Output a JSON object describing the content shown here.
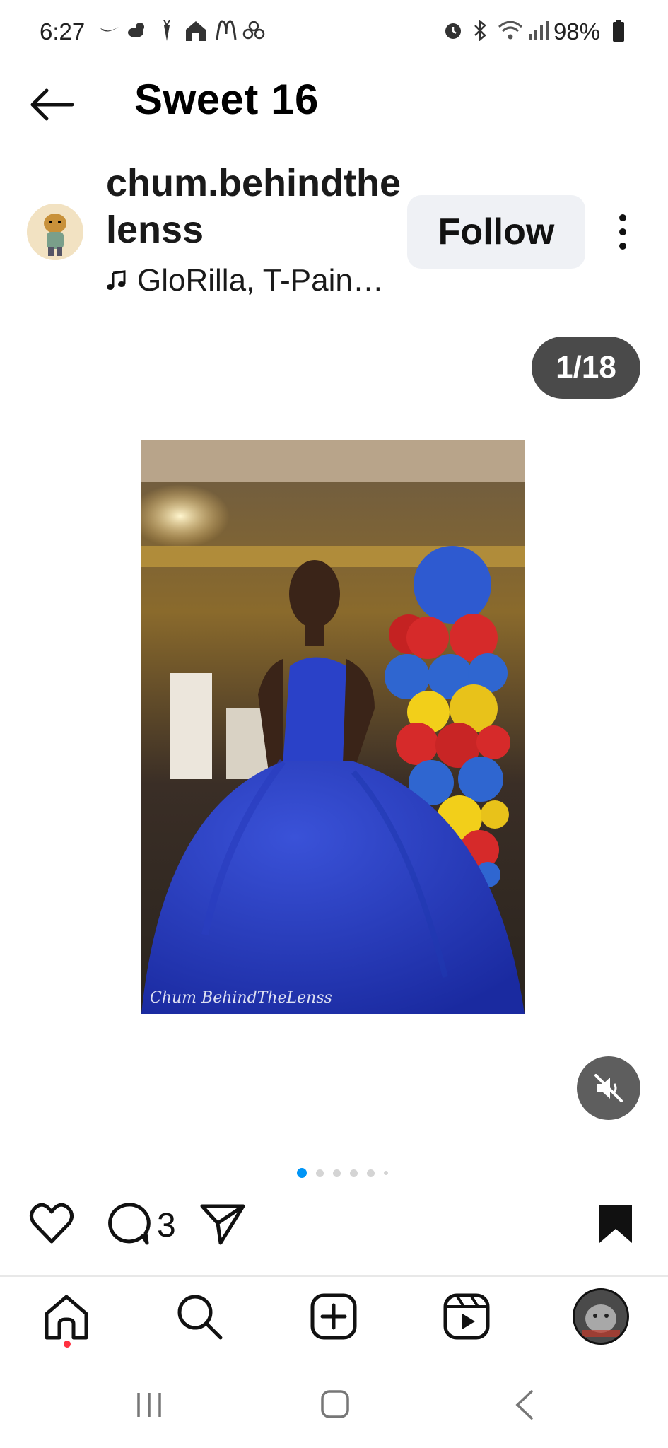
{
  "status_bar": {
    "time": "6:27",
    "battery": "98%",
    "icons": [
      "nike-icon",
      "weather-icon",
      "carrot-icon",
      "home-hands-icon",
      "mcdonalds-icon",
      "pinwheel-icon",
      "alarm-icon",
      "bluetooth-icon",
      "wifi-icon",
      "signal-icon",
      "battery-icon"
    ]
  },
  "header": {
    "title": "Sweet 16"
  },
  "post": {
    "username": "chum.behindthelenss",
    "audio": "GloRilla, T-Pain…",
    "follow_label": "Follow",
    "counter": "1/18",
    "watermark": "Chum BehindTheLenss",
    "comment_count": "3",
    "carousel_dots": 6,
    "active_dot": 0
  },
  "colors": {
    "accent_blue": "#0095f6",
    "follow_bg": "#eff1f5",
    "counter_bg": "#4a4a4a",
    "notification_dot": "#ff3040"
  },
  "bottom_nav": [
    "home-icon",
    "search-icon",
    "create-icon",
    "reels-icon",
    "profile-avatar"
  ]
}
